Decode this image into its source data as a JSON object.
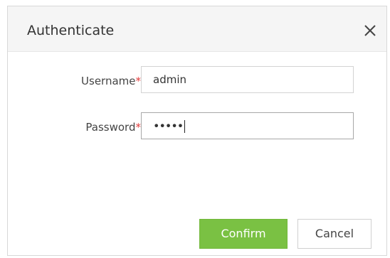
{
  "dialog": {
    "title": "Authenticate",
    "close_icon": "close-icon"
  },
  "form": {
    "username": {
      "label": "Username",
      "required_mark": "*",
      "value": "admin"
    },
    "password": {
      "label": "Password",
      "required_mark": "*",
      "masked_value": "•••••"
    }
  },
  "buttons": {
    "confirm_label": "Confirm",
    "cancel_label": "Cancel"
  },
  "colors": {
    "accent": "#7ac143",
    "required": "#e23a3a",
    "header_bg": "#f5f5f5"
  }
}
